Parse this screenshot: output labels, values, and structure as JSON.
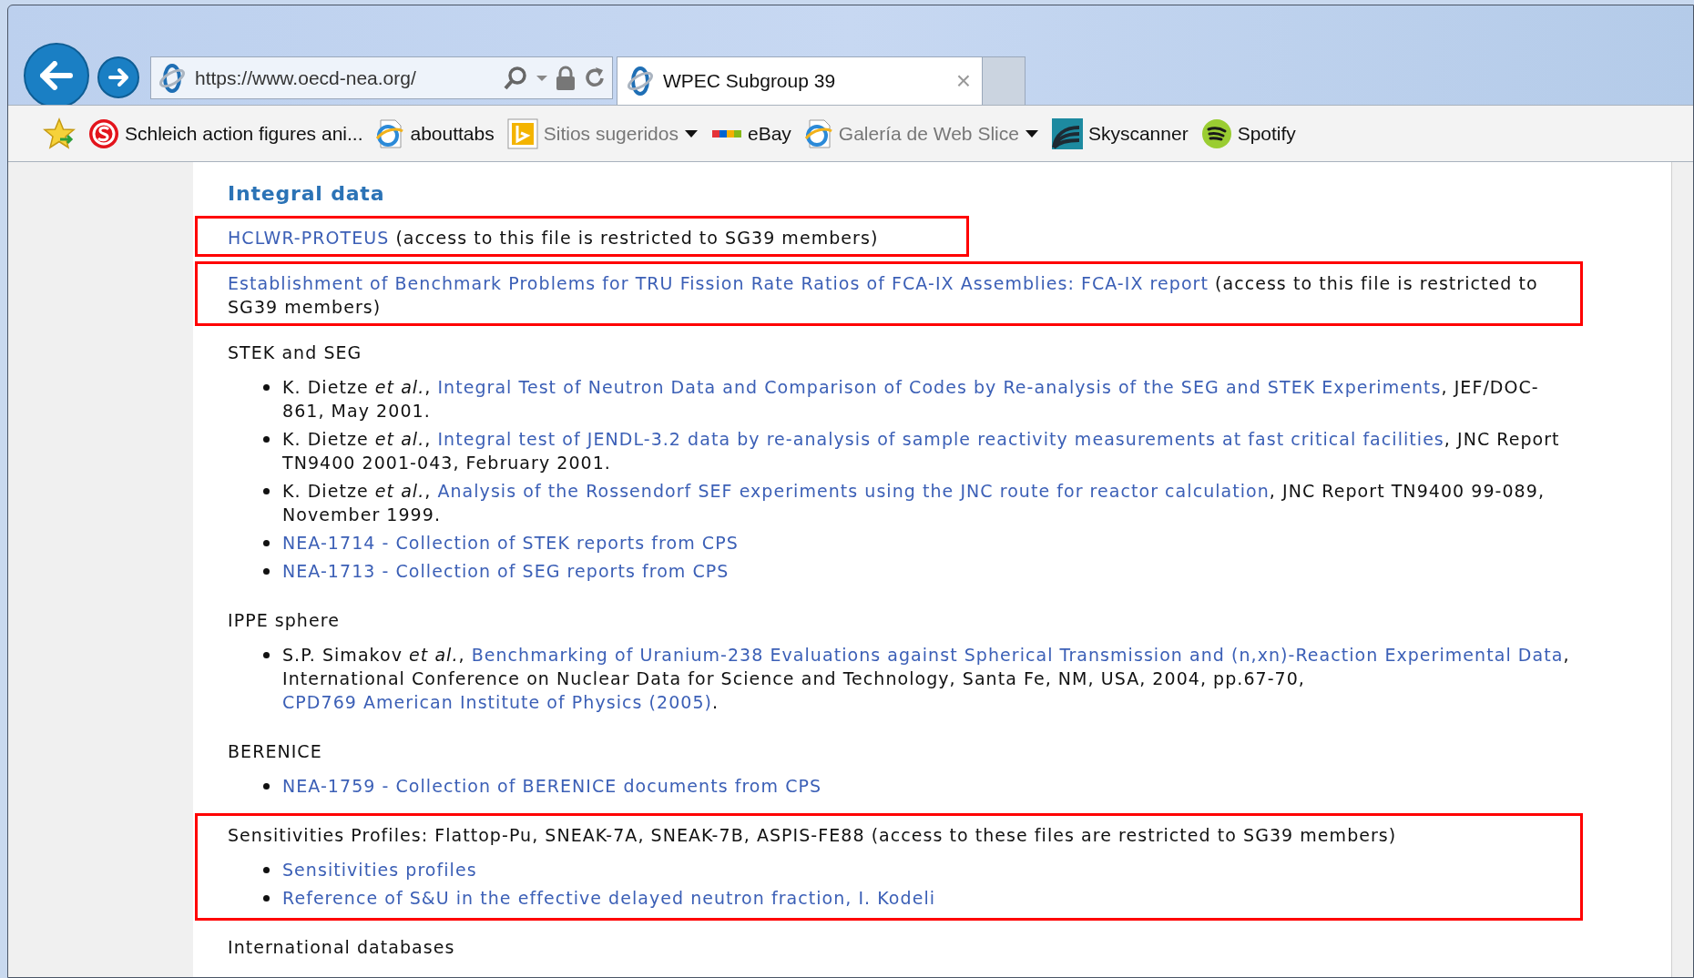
{
  "browser": {
    "address": "https://www.oecd-nea.org/",
    "tab": {
      "title": "WPEC Subgroup 39",
      "close": "×"
    },
    "favorites": [
      {
        "label": "Schleich action figures ani...",
        "dropdown": false
      },
      {
        "label": "abouttabs",
        "dropdown": false
      },
      {
        "label": "Sitios sugeridos",
        "dropdown": true
      },
      {
        "label": "eBay",
        "dropdown": false
      },
      {
        "label": "Galería de Web Slice",
        "dropdown": true
      },
      {
        "label": "Skyscanner",
        "dropdown": false
      },
      {
        "label": "Spotify",
        "dropdown": false
      }
    ]
  },
  "page": {
    "heading": "Integral data",
    "blocks": [
      {
        "highlighted": true,
        "paragraph": [
          {
            "text": "HCLWR-PROTEUS",
            "link": true
          },
          {
            "text": " (access to this file is restricted to SG39 members)",
            "link": false
          }
        ]
      },
      {
        "highlighted": true,
        "paragraph": [
          {
            "text": "Establishment of Benchmark Problems for TRU Fission Rate Ratios of FCA-IX Assemblies: FCA-IX report",
            "link": true
          },
          {
            "text": " (access to this file is restricted to SG39 members)",
            "link": false
          }
        ]
      },
      {
        "highlighted": false,
        "paragraph": [
          {
            "text": "STEK and SEG",
            "link": false
          }
        ],
        "items": [
          [
            {
              "text": "K. Dietze *et al.*, ",
              "link": false
            },
            {
              "text": "Integral Test of Neutron Data and Comparison of Codes by Re-analysis of the SEG and STEK Experiments",
              "link": true
            },
            {
              "text": ", JEF/DOC-861, May 2001.",
              "link": false
            }
          ],
          [
            {
              "text": "K. Dietze *et al.*, ",
              "link": false
            },
            {
              "text": "Integral test of JENDL-3.2 data by re-analysis of sample reactivity measurements at fast critical facilities",
              "link": true
            },
            {
              "text": ", JNC Report TN9400 2001-043, February 2001.",
              "link": false
            }
          ],
          [
            {
              "text": "K. Dietze *et al.*, ",
              "link": false
            },
            {
              "text": "Analysis of the Rossendorf SEF experiments using the JNC route for reactor calculation",
              "link": true
            },
            {
              "text": ", JNC Report TN9400 99-089, November 1999.",
              "link": false
            }
          ],
          [
            {
              "text": "NEA-1714 - Collection of STEK reports from CPS",
              "link": true
            }
          ],
          [
            {
              "text": "NEA-1713 - Collection of SEG reports from CPS",
              "link": true
            }
          ]
        ]
      },
      {
        "highlighted": false,
        "paragraph": [
          {
            "text": "IPPE sphere",
            "link": false
          }
        ],
        "items": [
          [
            {
              "text": "S.P. Simakov *et al.*, ",
              "link": false
            },
            {
              "text": "Benchmarking of Uranium-238 Evaluations against Spherical Transmission and (n,xn)-Reaction Experimental Data",
              "link": true
            },
            {
              "text": ", International Conference on Nuclear Data for Science and Technology, Santa Fe, NM, USA, 2004, pp.67-70, ",
              "link": false
            },
            {
              "text": "CPD769 American Institute of Physics (2005)",
              "link": true
            },
            {
              "text": ".",
              "link": false
            }
          ]
        ]
      },
      {
        "highlighted": false,
        "paragraph": [
          {
            "text": "BERENICE",
            "link": false
          }
        ],
        "items": [
          [
            {
              "text": "NEA-1759 - Collection of BERENICE documents from CPS",
              "link": true
            }
          ]
        ]
      },
      {
        "highlighted": true,
        "paragraph": [
          {
            "text": "Sensitivities Profiles: Flattop-Pu, SNEAK-7A, SNEAK-7B, ASPIS-FE88 (access to these files are restricted to SG39 members)",
            "link": false
          }
        ],
        "items": [
          [
            {
              "text": "Sensitivities profiles",
              "link": true
            }
          ],
          [
            {
              "text": "Reference of S&U in the effective delayed neutron fraction, I. Kodeli",
              "link": true
            }
          ]
        ]
      },
      {
        "highlighted": false,
        "paragraph": [
          {
            "text": "International databases",
            "link": false
          }
        ]
      }
    ]
  }
}
